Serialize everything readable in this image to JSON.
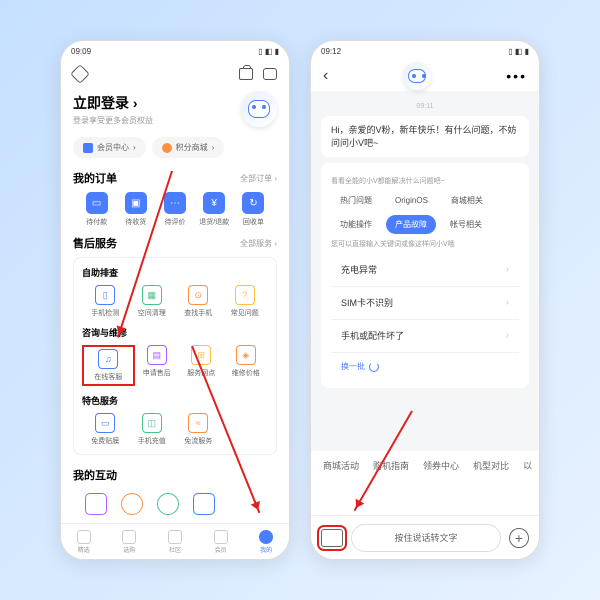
{
  "p1": {
    "time": "09:09",
    "login_title": "立即登录",
    "login_sub": "登录享受更多会员权益",
    "pill_member": "会员中心",
    "pill_points": "积分商城",
    "orders_title": "我的订单",
    "orders_more": "全部订单 ›",
    "orders": [
      "待付款",
      "待收货",
      "待评价",
      "退货/退款",
      "回收单"
    ],
    "aftersale_title": "售后服务",
    "aftersale_more": "全部服务 ›",
    "selfcheck_title": "自助排查",
    "selfcheck": [
      "手机检测",
      "空间清理",
      "查找手机",
      "常见问题"
    ],
    "consult_title": "咨询与维修",
    "consult": [
      "在线客服",
      "申请售后",
      "服务网点",
      "维修价格"
    ],
    "special_title": "特色服务",
    "special": [
      "免费贴膜",
      "手机充值",
      "免流服务"
    ],
    "interact_title": "我的互动",
    "tabs": [
      "精选",
      "选购",
      "社区",
      "会员",
      "我的"
    ]
  },
  "p2": {
    "time": "09:12",
    "chat_time": "09:11",
    "greeting": "Hi，亲爱的V粉，新年快乐！有什么问题，不妨问问小V吧~",
    "hint1": "看看全能的小V都能解决什么问题吧~",
    "chips": [
      "热门问题",
      "OriginOS",
      "商城相关",
      "功能操作",
      "产品故障",
      "帐号相关"
    ],
    "active_chip": "产品故障",
    "hint2": "您可以直接输入关键词或像这样问小V哦",
    "questions": [
      "充电异常",
      "SIM卡不识别",
      "手机或配件坏了"
    ],
    "refresh": "换一批",
    "suggest": [
      "商城活动",
      "购机指南",
      "领券中心",
      "机型对比",
      "以"
    ],
    "voice_label": "按住说话转文字"
  }
}
